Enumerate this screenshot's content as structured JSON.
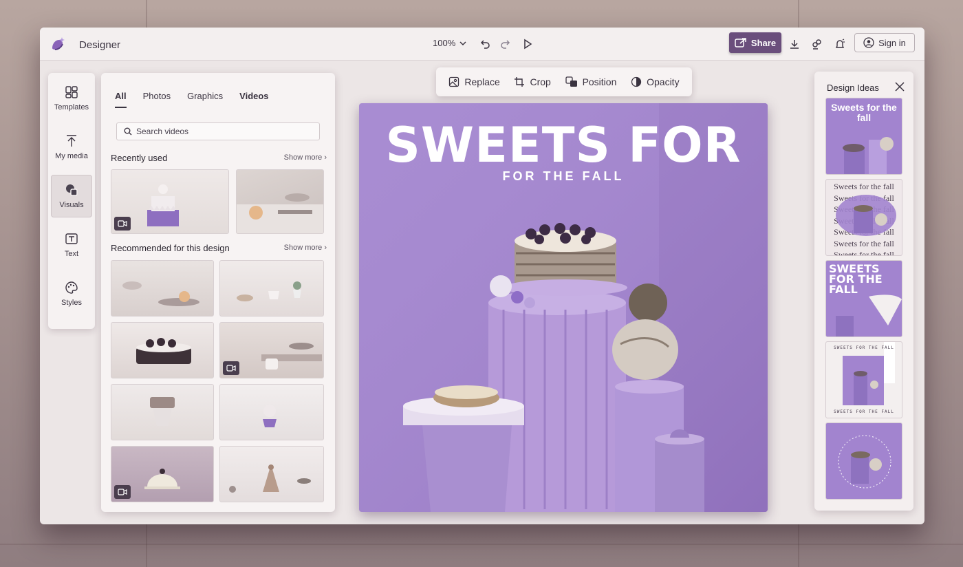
{
  "app": {
    "title": "Designer"
  },
  "toolbar": {
    "zoom": "100%",
    "share_label": "Share",
    "signin_label": "Sign in"
  },
  "rail": [
    {
      "label": "Templates",
      "icon": "templates-icon"
    },
    {
      "label": "My media",
      "icon": "upload-icon"
    },
    {
      "label": "Visuals",
      "icon": "visuals-icon"
    },
    {
      "label": "Text",
      "icon": "text-icon"
    },
    {
      "label": "Styles",
      "icon": "palette-icon"
    }
  ],
  "media": {
    "tabs": [
      "All",
      "Photos",
      "Graphics",
      "Videos"
    ],
    "active_tab": "All",
    "search_placeholder": "Search videos",
    "recent": {
      "title": "Recently used",
      "show_more": "Show more"
    },
    "recommended": {
      "title": "Recommended for this design",
      "show_more": "Show more"
    }
  },
  "context_toolbar": [
    "Replace",
    "Crop",
    "Position",
    "Opacity"
  ],
  "canvas": {
    "title": "SWEETS FOR",
    "subtitle": "FOR THE FALL",
    "background": "#a284cf"
  },
  "ideas": {
    "title": "Design Ideas",
    "idea1": "Sweets for the fall",
    "idea2_line": "Sweets for the fall",
    "idea3": "SWEETS FOR THE FALL",
    "idea4": "SWEETS FOR THE FALL"
  },
  "colors": {
    "accent": "#6a4e7c",
    "canvas": "#a284cf"
  }
}
